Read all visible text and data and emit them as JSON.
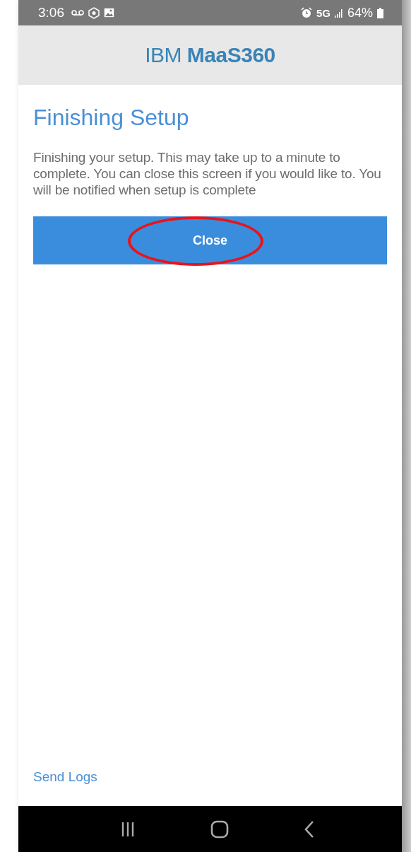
{
  "status_bar": {
    "time": "3:06",
    "network": "5G",
    "battery": "64%"
  },
  "header": {
    "brand_light": "IBM",
    "brand_bold": "MaaS360"
  },
  "title": "Finishing Setup",
  "message": "Finishing your setup. This may take up to a minute to complete. You can close this screen if you would like to. You will be notified when setup is complete",
  "button": {
    "label": "Close",
    "circled": true
  },
  "footer_link": "Send Logs"
}
